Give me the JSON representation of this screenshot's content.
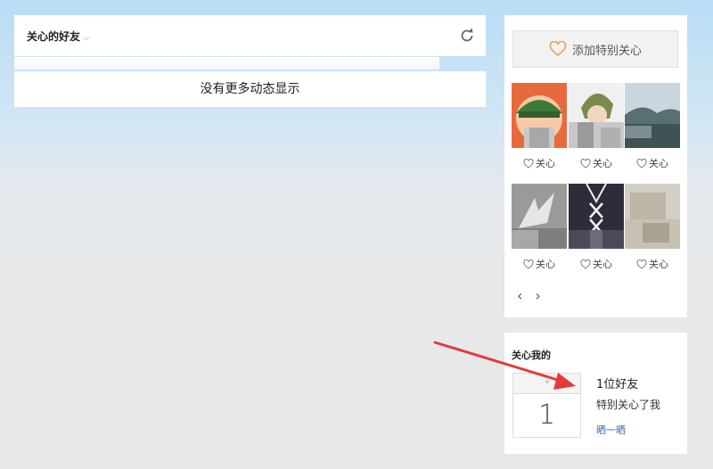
{
  "feed": {
    "title": "关心的好友",
    "title_chevron": "⌵",
    "empty_text": "没有更多动态显示"
  },
  "special_care": {
    "add_button_label": "添加特别关心",
    "friends": [
      {
        "care_label": "关心"
      },
      {
        "care_label": "关心"
      },
      {
        "care_label": "关心"
      },
      {
        "care_label": "关心"
      },
      {
        "care_label": "关心"
      },
      {
        "care_label": "关心"
      }
    ],
    "prev": "‹",
    "next": "›"
  },
  "cares_about_me": {
    "title": "关心我的",
    "calendar_number": "1",
    "count_text": "1位好友",
    "desc_text": "特别关心了我",
    "share_label": "晒一晒"
  },
  "colors": {
    "accent_red": "#e53a3a",
    "link_blue": "#2f66b3",
    "heart_orange": "#e8a25a"
  }
}
